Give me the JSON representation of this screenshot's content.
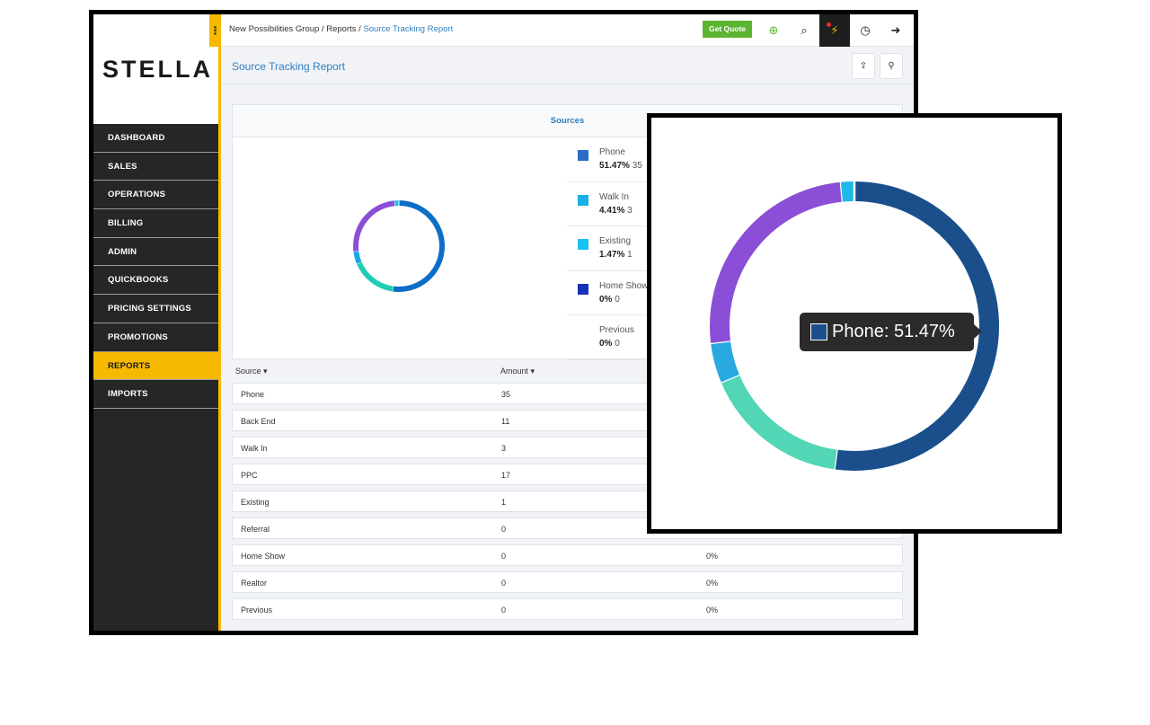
{
  "app": {
    "logo_text": "STELLA"
  },
  "breadcrumb": {
    "items": [
      "New Possibilities Group",
      "Reports"
    ],
    "separator": "/",
    "current": "Source Tracking Report"
  },
  "toolbar": {
    "get_quote_label": "Get Quote"
  },
  "sidebar": {
    "items": [
      {
        "label": "DASHBOARD",
        "active": false
      },
      {
        "label": "SALES",
        "active": false
      },
      {
        "label": "OPERATIONS",
        "active": false
      },
      {
        "label": "BILLING",
        "active": false
      },
      {
        "label": "ADMIN",
        "active": false
      },
      {
        "label": "QUICKBOOKS",
        "active": false
      },
      {
        "label": "PRICING SETTINGS",
        "active": false
      },
      {
        "label": "PROMOTIONS",
        "active": false
      },
      {
        "label": "REPORTS",
        "active": true
      },
      {
        "label": "IMPORTS",
        "active": false
      }
    ]
  },
  "page": {
    "title": "Source Tracking Report"
  },
  "panel": {
    "title": "Sources"
  },
  "legend": [
    {
      "name": "Phone",
      "pct": "51.47%",
      "count": "35",
      "color": "#2b6cc4"
    },
    {
      "name": "Walk In",
      "pct": "4.41%",
      "count": "3",
      "color": "#18aee6"
    },
    {
      "name": "Existing",
      "pct": "1.47%",
      "count": "1",
      "color": "#15c2f0"
    },
    {
      "name": "Home Show",
      "pct": "0%",
      "count": "0",
      "color": "#1433b8"
    },
    {
      "name": "Previous",
      "pct": "0%",
      "count": "0",
      "color": "#ffffff"
    }
  ],
  "table": {
    "headers": {
      "source": "Source ▾",
      "amount": "Amount ▾"
    },
    "rows": [
      {
        "source": "Phone",
        "amount": "35",
        "percent": ""
      },
      {
        "source": "Back End",
        "amount": "11",
        "percent": ""
      },
      {
        "source": "Walk In",
        "amount": "3",
        "percent": ""
      },
      {
        "source": "PPC",
        "amount": "17",
        "percent": ""
      },
      {
        "source": "Existing",
        "amount": "1",
        "percent": ""
      },
      {
        "source": "Referral",
        "amount": "0",
        "percent": ""
      },
      {
        "source": "Home Show",
        "amount": "0",
        "percent": "0%"
      },
      {
        "source": "Realtor",
        "amount": "0",
        "percent": "0%"
      },
      {
        "source": "Previous",
        "amount": "0",
        "percent": "0%"
      }
    ]
  },
  "chart_data": {
    "type": "pie",
    "categories": [
      "Phone",
      "Back End",
      "Walk In",
      "PPC",
      "Existing"
    ],
    "values": [
      35,
      11,
      3,
      17,
      1
    ],
    "colors_small": [
      "#0d6ec7",
      "#1fcfb3",
      "#1ba8e3",
      "#8a4fd6",
      "#1ebfe8"
    ],
    "colors_zoom": [
      "#1b4f8c",
      "#52d6b5",
      "#2aa9e0",
      "#8a4fd6",
      "#20b8ea"
    ],
    "donut": true
  },
  "tooltip": {
    "text": "Phone: 51.47%"
  },
  "icons": {
    "kebab": "⋮",
    "add": "⊕",
    "search": "⌕",
    "bolt": "⚡",
    "clock": "◷",
    "exit": "➜",
    "share": "⇪",
    "find": "⚲"
  }
}
